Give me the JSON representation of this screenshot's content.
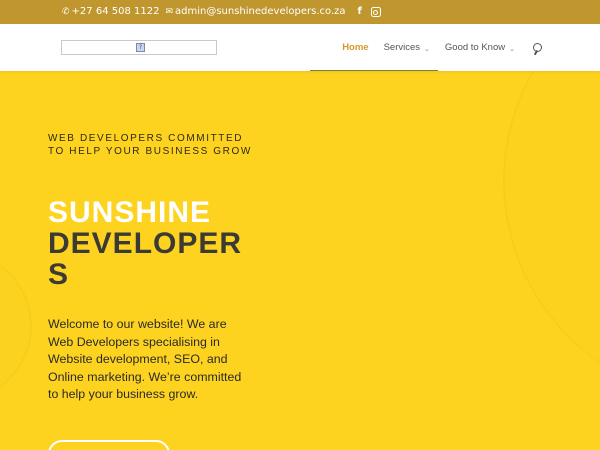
{
  "topbar": {
    "phone": "+27 64 508 1122",
    "email": "admin@sunshinedevelopers.co.za",
    "icons": [
      "phone-icon",
      "email-icon",
      "facebook-icon",
      "instagram-icon"
    ],
    "facebook_glyph": "f",
    "color": "#c0962f"
  },
  "header": {
    "logo_broken_glyph": "?",
    "nav": [
      {
        "label": "Home",
        "active": true
      },
      {
        "label": "Services",
        "has_dropdown": true
      },
      {
        "label": "Good to Know",
        "has_dropdown": true
      }
    ],
    "chevron_glyph": "⌄",
    "active_color": "#d39b2f"
  },
  "hero": {
    "tagline": "WEB DEVELOPERS COMMITTED TO HELP YOUR BUSINESS GROW",
    "title_line1": "SUNSHINE",
    "title_line2": "DEVELOPERS",
    "intro": "Welcome to our website! We are Web Developers specialising in Website development, SEO, and Online marketing. We’re committed to help your business grow.",
    "background_color": "#fdd320"
  }
}
